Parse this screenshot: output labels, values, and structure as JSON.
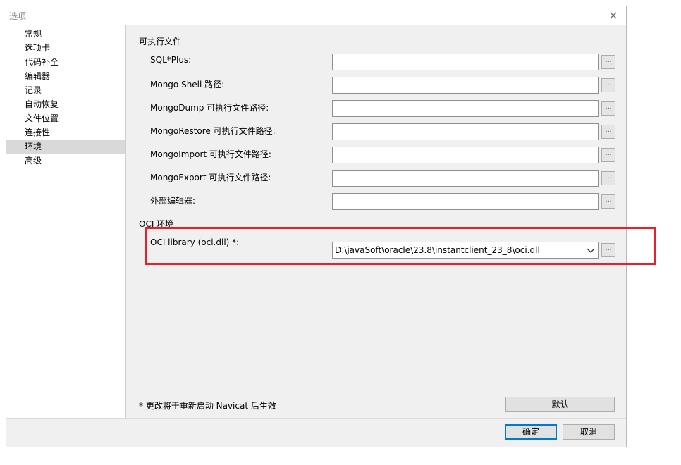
{
  "window": {
    "title": "选项",
    "close_icon": "×"
  },
  "sidebar": {
    "items": [
      {
        "label": "常规",
        "selected": false
      },
      {
        "label": "选项卡",
        "selected": false
      },
      {
        "label": "代码补全",
        "selected": false
      },
      {
        "label": "编辑器",
        "selected": false
      },
      {
        "label": "记录",
        "selected": false
      },
      {
        "label": "自动恢复",
        "selected": false
      },
      {
        "label": "文件位置",
        "selected": false
      },
      {
        "label": "连接性",
        "selected": false
      },
      {
        "label": "环境",
        "selected": true
      },
      {
        "label": "高级",
        "selected": false
      }
    ]
  },
  "executables": {
    "section_title": "可执行文件",
    "rows": [
      {
        "label": "SQL*Plus:",
        "value": "",
        "browse": "..."
      },
      {
        "label": "Mongo Shell 路径:",
        "value": "",
        "browse": "..."
      },
      {
        "label": "MongoDump 可执行文件路径:",
        "value": "",
        "browse": "..."
      },
      {
        "label": "MongoRestore 可执行文件路径:",
        "value": "",
        "browse": "..."
      },
      {
        "label": "MongoImport 可执行文件路径:",
        "value": "",
        "browse": "..."
      },
      {
        "label": "MongoExport 可执行文件路径:",
        "value": "",
        "browse": "..."
      },
      {
        "label": "外部编辑器:",
        "value": "",
        "browse": "..."
      }
    ]
  },
  "oci": {
    "section_title": "OCI 环境",
    "label": "OCI library (oci.dll) *:",
    "value": "D:\\javaSoft\\oracle\\23.8\\instantclient_23_8\\oci.dll",
    "browse": "..."
  },
  "note": "* 更改将于重新启动 Navicat 后生效",
  "buttons": {
    "default": "默认",
    "ok": "确定",
    "cancel": "取消"
  },
  "colors": {
    "highlight": "#e8202a",
    "selected_bg": "#d9d9d9",
    "primary_border": "#0078d7"
  }
}
